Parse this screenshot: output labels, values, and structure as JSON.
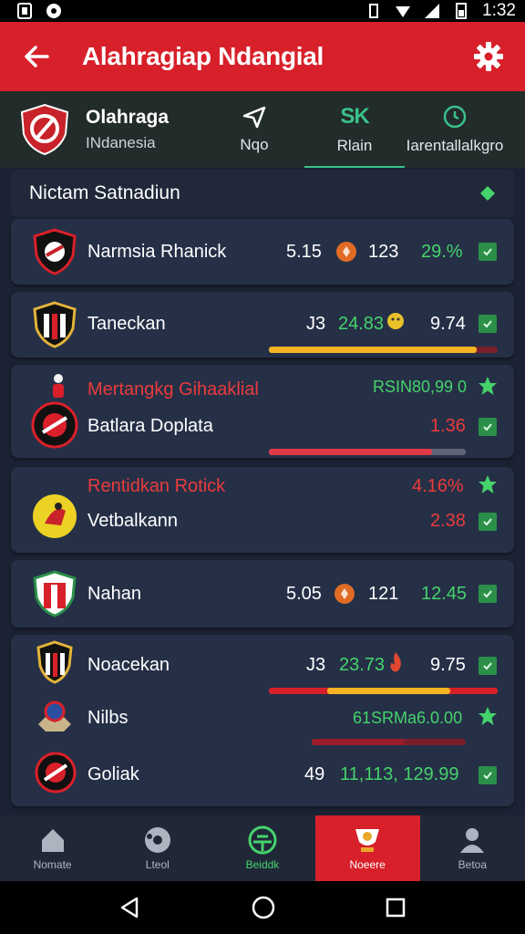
{
  "status_bar": {
    "time": "1:32"
  },
  "app_bar": {
    "title": "Alahragiap Ndangial"
  },
  "league": {
    "name": "Olahraga",
    "country": "INdanesia"
  },
  "tabs": [
    {
      "label": "Nqo",
      "icon": "send-icon"
    },
    {
      "label": "Rlain",
      "icon": "sk-icon",
      "badge": "SK"
    },
    {
      "label": "Iarentallalkgro",
      "icon": "clock-icon"
    }
  ],
  "section": {
    "title": "Nictam Satnadiun"
  },
  "cards": [
    {
      "name": "Narmsia Rhanick",
      "score1": "5.15",
      "score2": "123",
      "pct": "29.%"
    },
    {
      "name": "Taneckan",
      "score1": "J3",
      "score2": "24.83",
      "score3": "9.74",
      "bar_progress": 0.91
    },
    {
      "promo": "Mertangkg Gihaaklial",
      "promo_value": "RSIN80,99 0",
      "name": "Batlara Doplata",
      "value": "1.36",
      "bar_progress": 0.83
    },
    {
      "promo": "Rentidkan Rotick",
      "promo_value": "4.16%",
      "name": "Vetbalkann",
      "value": "2.38"
    },
    {
      "name": "Nahan",
      "score1": "5.05",
      "score2": "121",
      "pct": "12.45"
    }
  ],
  "group": {
    "rows": [
      {
        "name": "Noacekan",
        "score1": "J3",
        "score2": "23.73",
        "score3": "9.75",
        "bar_progress": 0.89
      },
      {
        "name": "Nilbs",
        "promo_value": "61SRMa6.0.00",
        "bar_progress": 0.6
      },
      {
        "name": "Goliak",
        "score1": "49",
        "score2": "11,113, 129.99"
      }
    ]
  },
  "bottom_nav": [
    {
      "label": "Nomate",
      "icon": "home-icon"
    },
    {
      "label": "Lteol",
      "icon": "ball-icon"
    },
    {
      "label": "Beiddk",
      "icon": "stadium-icon"
    },
    {
      "label": "Noeere",
      "icon": "trophy-icon",
      "active": true
    },
    {
      "label": "Betoa",
      "icon": "profile-icon"
    }
  ],
  "colors": {
    "brand_red": "#d8202a",
    "accent_green": "#45d36b",
    "bar_yellow": "#f4b323",
    "bar_red": "#e03a48"
  }
}
